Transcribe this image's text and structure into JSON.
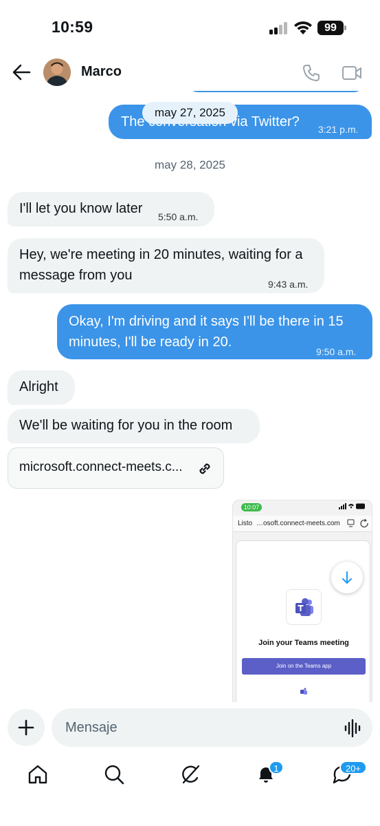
{
  "status_bar": {
    "time": "10:59",
    "battery": "99"
  },
  "header": {
    "contact_name": "Marco"
  },
  "date_pill": "may 27, 2025",
  "date_separator": "may 28, 2025",
  "messages": [
    {
      "direction": "outgoing",
      "text": "The conversation via Twitter?",
      "time": "3:21 p.m."
    },
    {
      "direction": "incoming",
      "text": "I'll let you know later",
      "time": "5:50 a.m."
    },
    {
      "direction": "incoming",
      "text": "Hey, we're meeting in 20 minutes, waiting for a message from you",
      "time": "9:43 a.m."
    },
    {
      "direction": "outgoing",
      "text": "Okay, I'm driving and it says I'll be there in 15 minutes, I'll be ready in 20.",
      "time": "9:50 a.m."
    },
    {
      "direction": "incoming",
      "text": "Alright"
    },
    {
      "direction": "incoming",
      "text": "We'll be waiting for you in the room"
    }
  ],
  "link_card": {
    "text": "microsoft.connect-meets.c..."
  },
  "preview": {
    "time": "10:07",
    "battery": "3",
    "done_label": "Listo",
    "url": "…osoft.connect-meets.com",
    "heading": "Join your Teams meeting",
    "button_label": "Join on the Teams app"
  },
  "composer": {
    "placeholder": "Mensaje"
  },
  "tab_bar": {
    "items": [
      "home",
      "search",
      "grok",
      "notifications",
      "messages"
    ],
    "notifications_badge": "1",
    "messages_badge": "20+"
  },
  "colors": {
    "accent": "#1d9bf0",
    "outgoing_bubble": "#3b94e8",
    "incoming_bubble": "#eff3f4",
    "teams_purple": "#5b5fc7"
  }
}
